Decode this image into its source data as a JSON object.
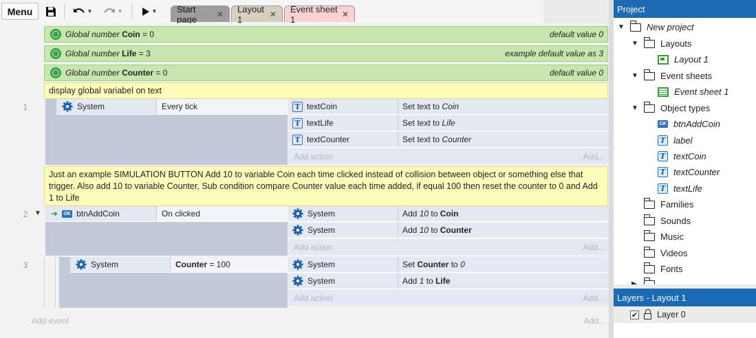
{
  "toolbar": {
    "menu_label": "Menu"
  },
  "tabs": [
    {
      "label": "Start page"
    },
    {
      "label": "Layout 1"
    },
    {
      "label": "Event sheet 1"
    }
  ],
  "global_vars": [
    {
      "prefix": "Global number",
      "name": "Coin",
      "value": "= 0",
      "comment": "default value 0"
    },
    {
      "prefix": "Global number",
      "name": "Life",
      "value": "= 3",
      "comment": "example default value as 3"
    },
    {
      "prefix": "Global number",
      "name": "Counter",
      "value": "= 0",
      "comment": "default value 0"
    }
  ],
  "comments": [
    "display global variabel on text",
    "Just an example SIMULATION BUTTON Add 10 to variable Coin each time clicked instead of collision between object or something else that trigger. Also add 10 to variable Counter, Sub condition compare Counter value each time added, if equal 100 then reset the counter to 0 and Add 1 to Life"
  ],
  "events": [
    {
      "number": "1",
      "condition": {
        "object": "System",
        "text": "Every tick"
      },
      "actions": [
        {
          "object": "textCoin",
          "pre": "Set text to",
          "val": "Coin"
        },
        {
          "object": "textLife",
          "pre": "Set text to",
          "val": "Life"
        },
        {
          "object": "textCounter",
          "pre": "Set text to",
          "val": "Counter"
        }
      ]
    },
    {
      "number": "2",
      "condition": {
        "object": "btnAddCoin",
        "text": "On clicked"
      },
      "actions": [
        {
          "object": "System",
          "pre": "Add",
          "num": "10",
          "mid": "to",
          "target": "Coin"
        },
        {
          "object": "System",
          "pre": "Add",
          "num": "10",
          "mid": "to",
          "target": "Counter"
        }
      ]
    },
    {
      "number": "3",
      "condition": {
        "object": "System",
        "var": "Counter",
        "text": "= 100"
      },
      "actions": [
        {
          "object": "System",
          "pre": "Set",
          "target": "Counter",
          "mid": "to",
          "num": "0"
        },
        {
          "object": "System",
          "pre": "Add",
          "num": "1",
          "mid": "to",
          "target": "Life"
        }
      ]
    }
  ],
  "add_action": {
    "label": "Add action",
    "right": "Add..."
  },
  "add_event": {
    "label": "Add event",
    "right": "Add..."
  },
  "project": {
    "title": "Project",
    "tree": {
      "root": "New project",
      "layouts": "Layouts",
      "layout1": "Layout 1",
      "event_sheets": "Event sheets",
      "event_sheet1": "Event sheet 1",
      "object_types": "Object types",
      "objects": [
        "btnAddCoin",
        "label",
        "textCoin",
        "textCounter",
        "textLife"
      ],
      "families": "Families",
      "sounds": "Sounds",
      "music": "Music",
      "videos": "Videos",
      "fonts": "Fonts"
    }
  },
  "layers": {
    "title": "Layers - Layout 1",
    "layer0": "Layer 0"
  },
  "colors": {
    "panel_header": "#1c69b4",
    "global_var_bg": "#c8e6ad",
    "comment_bg": "#fdfdbb",
    "block_bg": "#c2c9d9",
    "tab_event_sheet": "#f8d2d2"
  }
}
